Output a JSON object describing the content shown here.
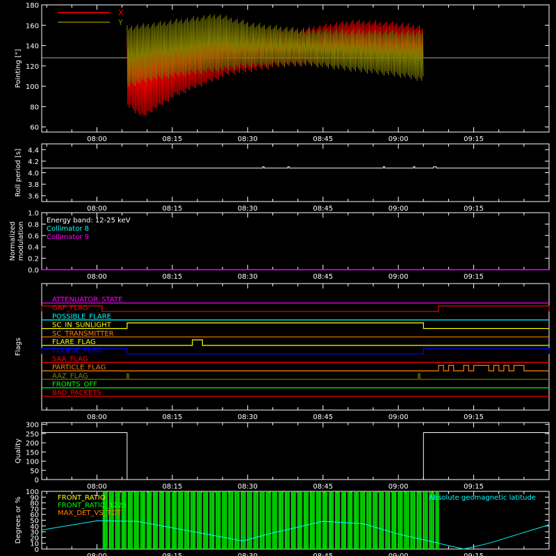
{
  "time_ticks": [
    "08:00",
    "08:15",
    "08:30",
    "08:45",
    "09:00",
    "09:15"
  ],
  "colors": {
    "axis": "#ffffff",
    "red": "#ff0000",
    "olive": "#808000",
    "cyan": "#00ffff",
    "magenta": "#ff00ff",
    "yellow": "#ffff00",
    "orange": "#ff8000",
    "blue": "#0000ff",
    "green": "#00ff00",
    "lime": "#00ff00",
    "crimson": "#e00000"
  },
  "chart_data": [
    {
      "id": "pointing",
      "type": "line",
      "title": "",
      "xlabel": "",
      "ylabel": "Pointing [\"]",
      "ylim": [
        55,
        180
      ],
      "yticks": [
        "60",
        "80",
        "100",
        "120",
        "140",
        "160",
        "180"
      ],
      "legend": [
        "X",
        "Y"
      ],
      "reference_line": 128,
      "series": [
        {
          "name": "X",
          "color": "#ff0000",
          "start": "08:06",
          "end": "09:05",
          "upper": [
            [
              0,
              148
            ],
            [
              5,
              150
            ],
            [
              15,
              156
            ],
            [
              25,
              157
            ],
            [
              35,
              158
            ],
            [
              45,
              166
            ],
            [
              55,
              163
            ],
            [
              59,
              160
            ]
          ],
          "lower": [
            [
              0,
              80
            ],
            [
              3,
              68
            ],
            [
              10,
              90
            ],
            [
              20,
              110
            ],
            [
              30,
              118
            ],
            [
              40,
              120
            ],
            [
              50,
              118
            ],
            [
              59,
              122
            ]
          ]
        },
        {
          "name": "Y",
          "color": "#808000",
          "start": "08:06",
          "end": "09:05",
          "upper": [
            [
              0,
              160
            ],
            [
              5,
              163
            ],
            [
              12,
              168
            ],
            [
              18,
              172
            ],
            [
              25,
              163
            ],
            [
              35,
              157
            ],
            [
              45,
              156
            ],
            [
              55,
              155
            ],
            [
              59,
              156
            ]
          ],
          "lower": [
            [
              0,
              98
            ],
            [
              5,
              105
            ],
            [
              15,
              112
            ],
            [
              25,
              118
            ],
            [
              35,
              120
            ],
            [
              45,
              114
            ],
            [
              55,
              108
            ],
            [
              59,
              104
            ]
          ]
        }
      ]
    },
    {
      "id": "roll_period",
      "type": "line",
      "title": "",
      "xlabel": "",
      "ylabel": "Roll period [s]",
      "ylim": [
        3.5,
        4.5
      ],
      "yticks": [
        "3.6",
        "3.8",
        "4.0",
        "4.2",
        "4.4"
      ],
      "series": [
        {
          "name": "",
          "color": "#ffffff",
          "value": 4.08
        }
      ]
    },
    {
      "id": "modulation",
      "type": "line",
      "title": "",
      "xlabel": "",
      "ylabel": "Normalized modulation",
      "ylabel_lines": [
        "Normalized",
        "modulation"
      ],
      "ylim": [
        0,
        1.0
      ],
      "yticks": [
        "0.0",
        "0.2",
        "0.4",
        "0.6",
        "0.8",
        "1.0"
      ],
      "annotations": [
        {
          "text": "Energy band: 12-25 keV",
          "color": "#ffffff"
        },
        {
          "text": "Collimator 8",
          "color": "#00ffff"
        },
        {
          "text": "Collimator 9",
          "color": "#ff00ff"
        }
      ],
      "series": [
        {
          "name": "Collimator 9",
          "color": "#ff00ff",
          "value": 0.0
        }
      ]
    },
    {
      "id": "flags",
      "type": "line",
      "title": "",
      "xlabel": "",
      "ylabel": "Flags",
      "rows": [
        {
          "label": "ATTENUATOR_STATE",
          "color": "#ff00ff",
          "segments": []
        },
        {
          "label": "GAP_FLAG",
          "color": "#ff0000",
          "segments": [
            [
              "07:49",
              "08:01"
            ],
            [
              "09:08",
              "09:30"
            ]
          ]
        },
        {
          "label": "POSSIBLE_FLARE",
          "color": "#00ffff",
          "segments": []
        },
        {
          "label": "SC_IN_SUNLIGHT",
          "color": "#ffff00",
          "segments": [
            [
              "08:06",
              "09:05"
            ]
          ]
        },
        {
          "label": "SC_TRANSMITTER",
          "color": "#ff8000",
          "segments": []
        },
        {
          "label": "FLARE_FLAG",
          "color": "#ffff00",
          "segments": [
            [
              "08:19",
              "08:21"
            ]
          ]
        },
        {
          "label": "ECLIPSE_FLAG",
          "color": "#0000ff",
          "segments": [
            [
              "07:49",
              "08:06"
            ],
            [
              "09:05",
              "09:30"
            ]
          ]
        },
        {
          "label": "SAA_FLAG",
          "color": "#ff0000",
          "segments": []
        },
        {
          "label": "PARTICLE_FLAG",
          "color": "#ff8000",
          "segments": [
            [
              "09:08",
              "09:09"
            ],
            [
              "09:10",
              "09:11"
            ],
            [
              "09:13",
              "09:14"
            ],
            [
              "09:15",
              "09:18"
            ],
            [
              "09:19",
              "09:20"
            ],
            [
              "09:21",
              "09:22"
            ],
            [
              "09:23",
              "09:25"
            ]
          ]
        },
        {
          "label": "AAZ_FLAG",
          "color": "#808000",
          "segments": [
            [
              "08:06",
              "08:06"
            ],
            [
              "09:04",
              "09:04"
            ]
          ]
        },
        {
          "label": "FRONTS_OFF",
          "color": "#00ff00",
          "segments": []
        },
        {
          "label": "BAD_PACKETS",
          "color": "#ff0000",
          "segments": []
        }
      ]
    },
    {
      "id": "quality",
      "type": "line",
      "title": "",
      "xlabel": "",
      "ylabel": "Quality",
      "ylim": [
        0,
        310
      ],
      "yticks": [
        "0",
        "50",
        "100",
        "150",
        "200",
        "250",
        "300"
      ],
      "series": [
        {
          "name": "",
          "color": "#ffffff",
          "points": [
            [
              "07:49",
              255
            ],
            [
              "08:06",
              255
            ],
            [
              "08:06",
              0
            ],
            [
              "09:05",
              0
            ],
            [
              "09:05",
              255
            ],
            [
              "09:30",
              255
            ]
          ]
        }
      ]
    },
    {
      "id": "latitude",
      "type": "line",
      "title": "",
      "xlabel": "",
      "ylabel": "Degrees or %",
      "ylim": [
        0,
        100
      ],
      "yticks": [
        "0",
        "10",
        "20",
        "30",
        "40",
        "50",
        "60",
        "70",
        "80",
        "90",
        "100"
      ],
      "legend": [
        {
          "text": "FRONT_RATIO",
          "color": "#ffff00"
        },
        {
          "text": "FRONT_RATIO_1225",
          "color": "#00ff00"
        },
        {
          "text": "MAX_DET_VS_TOT",
          "color": "#ff8000"
        }
      ],
      "annotation": {
        "text": "Absolute geomagnetic latitude",
        "color": "#00ffff"
      },
      "series": [
        {
          "name": "Absolute geomagnetic latitude",
          "color": "#00ffff",
          "points": [
            [
              "07:49",
              33
            ],
            [
              "08:00",
              49
            ],
            [
              "08:08",
              48
            ],
            [
              "08:23",
              24
            ],
            [
              "08:29",
              14
            ],
            [
              "08:35",
              28
            ],
            [
              "08:45",
              48
            ],
            [
              "08:53",
              44
            ],
            [
              "09:00",
              26
            ],
            [
              "09:08",
              10
            ],
            [
              "09:13",
              0
            ],
            [
              "09:18",
              10
            ],
            [
              "09:30",
              42
            ]
          ]
        },
        {
          "name": "FRONT_RATIO_1225",
          "color": "#00ff00",
          "start": "08:01",
          "end": "09:08"
        }
      ]
    }
  ]
}
